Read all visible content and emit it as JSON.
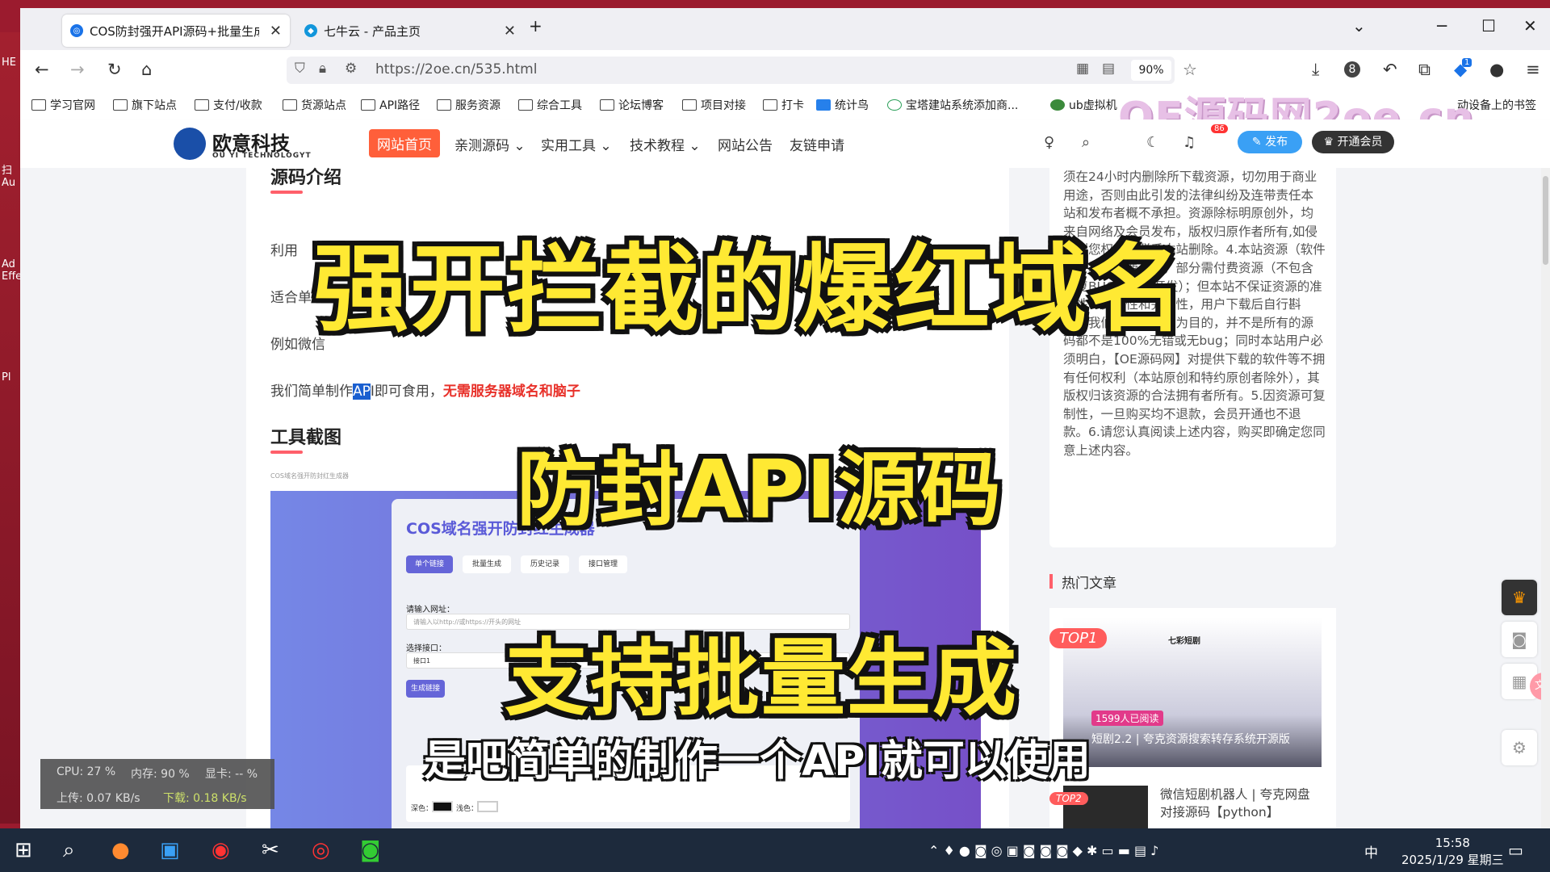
{
  "desktop": {
    "icon_labels": [
      "HE",
      "扫\nAu",
      "Ad\nEffe",
      "Pl"
    ]
  },
  "tabs": [
    {
      "title": "COS防封强开API源码+批量生成",
      "favicon_color": "#1a73e8"
    },
    {
      "title": "七牛云 - 产品主页",
      "favicon_color": "#1296db"
    }
  ],
  "new_tab": "+",
  "url": "https://2oe.cn/535.html",
  "zoom": "90%",
  "ext_badge": "1",
  "bookmarks": [
    "学习官网",
    "旗下站点",
    "支付/收款",
    "货源站点",
    "API路径",
    "服务资源",
    "综合工具",
    "论坛博客",
    "项目对接",
    "打卡",
    "统计鸟",
    "宝塔建站系统添加商...",
    "ub虚拟机",
    "动设备上的书签"
  ],
  "watermark": "OE源码网2oe.cn",
  "site": {
    "logo_title": "欧意科技",
    "logo_sub": "OU YI TECHNOLOGYT",
    "menu": [
      "网站首页",
      "亲测源码",
      "实用工具",
      "技术教程",
      "网站公告",
      "友链申请"
    ],
    "publish": "✎ 发布",
    "vip": "开通会员",
    "notif_count": "86"
  },
  "article": {
    "section1": "源码介绍",
    "p1": "利用",
    "p2": "适合单",
    "p3": "例如微信",
    "p4_a": "我们简单制作",
    "p4_hl": "AP",
    "p4_b": "I即可食用，",
    "p4_red": "无需服务器域名和脑子",
    "section2": "工具截图",
    "shot_caption": "COS域名强开防封红生成器",
    "card_title": "COS域名强开防封红生成器",
    "card_tabs": [
      "单个链接",
      "批量生成",
      "历史记录",
      "接口管理"
    ],
    "label_url": "请输入网址：",
    "ph_url": "请输入以http://或https://开头的网址",
    "label_api": "选择接口：",
    "api_value": "接口1",
    "gen_btn": "生成链接",
    "color_dark": "深色：",
    "color_light": "浅色："
  },
  "sidebar": {
    "text": "须在24小时内删除所下载资源，切勿用于商业用途，否则由此引发的法律纠纷及连带责任本站和发布者概不承担。资源除标明原创外，均来自网络及会员发布，版权归原作者所有,如侵犯到您权益请联系本站删除。4.本站资源（软件等）均为免费分享，部分需付费资源（不包含修复BUG及二次开发）；但本站不保证资源的准确性、安全性和完整性，用户下载后自行斟酌，我们以交流学习为目的，并不是所有的源码都不是100%无错或无bug；同时本站用户必须明白，【OE源码网】对提供下载的软件等不拥有任何权利（本站原创和特约原创者除外），其版权归该资源的合法拥有者所有。5.因资源可复制性，一旦购买均不退款，会员开通也不退款。6.请您认真阅读上述内容，购买即确定您同意上述内容。",
    "hot_title": "热门文章",
    "top1": "TOP1",
    "top1_reads": "1599人已阅读",
    "top1_title": "短剧2.2 | 夸克资源搜索转存系统开源版",
    "top1_site": "七彩短剧",
    "top2": "TOP2",
    "top2_title": "微信短剧机器人 | 夸克网盘对接源码【python】"
  },
  "captions": {
    "c1": "强开拦截的爆红域名",
    "c2": "防封API源码",
    "c3": "支持批量生成",
    "c4": "是吧简单的制作一个API就可以使用"
  },
  "monitor": {
    "cpu": "CPU: 27 %",
    "mem": "内存: 90 %",
    "gpu": "显卡: -- %",
    "up": "上传: 0.07 KB/s",
    "down": "下载: 0.18 KB/s"
  },
  "taskbar": {
    "ime": "中",
    "time": "15:58",
    "date": "2025/1/29 星期三"
  }
}
